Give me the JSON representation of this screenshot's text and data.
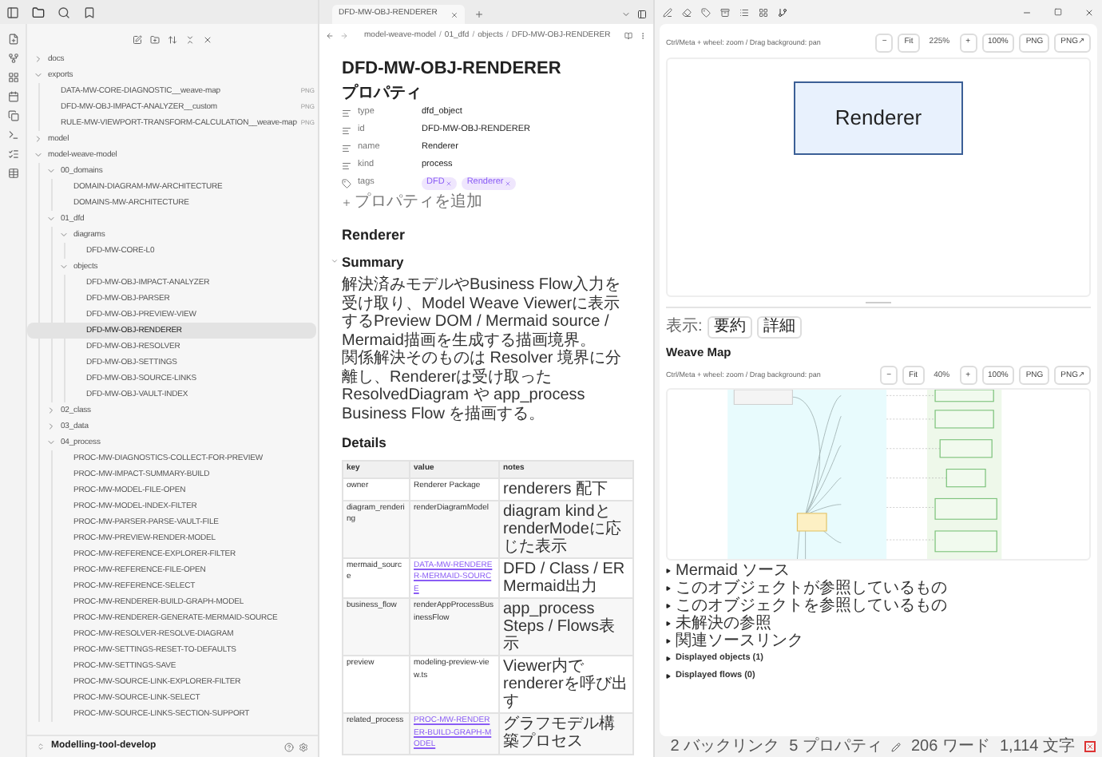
{
  "sidebar": {
    "tree": [
      {
        "label": "docs",
        "kind": "folder",
        "expanded": false,
        "selected": false
      },
      {
        "label": "exports",
        "kind": "folder",
        "expanded": true,
        "selected": false,
        "children": [
          {
            "label": "DATA-MW-CORE-DIAGNOSTIC__weave-map",
            "kind": "file",
            "badge": "PNG",
            "selected": false
          },
          {
            "label": "DFD-MW-OBJ-IMPACT-ANALYZER__custom",
            "kind": "file",
            "badge": "PNG",
            "selected": false
          },
          {
            "label": "RULE-MW-VIEWPORT-TRANSFORM-CALCULATION__weave-map",
            "kind": "file",
            "badge": "PNG",
            "selected": false
          }
        ]
      },
      {
        "label": "model",
        "kind": "folder",
        "expanded": false,
        "selected": false
      },
      {
        "label": "model-weave-model",
        "kind": "folder",
        "expanded": true,
        "selected": false,
        "children": [
          {
            "label": "00_domains",
            "kind": "folder",
            "expanded": true,
            "selected": false,
            "children": [
              {
                "label": "DOMAIN-DIAGRAM-MW-ARCHITECTURE",
                "kind": "file",
                "selected": false
              },
              {
                "label": "DOMAINS-MW-ARCHITECTURE",
                "kind": "file",
                "selected": false
              }
            ]
          },
          {
            "label": "01_dfd",
            "kind": "folder",
            "expanded": true,
            "selected": false,
            "children": [
              {
                "label": "diagrams",
                "kind": "folder",
                "expanded": true,
                "selected": false,
                "children": [
                  {
                    "label": "DFD-MW-CORE-L0",
                    "kind": "file",
                    "selected": false
                  }
                ]
              },
              {
                "label": "objects",
                "kind": "folder",
                "expanded": true,
                "selected": false,
                "children": [
                  {
                    "label": "DFD-MW-OBJ-IMPACT-ANALYZER",
                    "kind": "file",
                    "selected": false
                  },
                  {
                    "label": "DFD-MW-OBJ-PARSER",
                    "kind": "file",
                    "selected": false
                  },
                  {
                    "label": "DFD-MW-OBJ-PREVIEW-VIEW",
                    "kind": "file",
                    "selected": false
                  },
                  {
                    "label": "DFD-MW-OBJ-RENDERER",
                    "kind": "file",
                    "selected": true
                  },
                  {
                    "label": "DFD-MW-OBJ-RESOLVER",
                    "kind": "file",
                    "selected": false
                  },
                  {
                    "label": "DFD-MW-OBJ-SETTINGS",
                    "kind": "file",
                    "selected": false
                  },
                  {
                    "label": "DFD-MW-OBJ-SOURCE-LINKS",
                    "kind": "file",
                    "selected": false
                  },
                  {
                    "label": "DFD-MW-OBJ-VAULT-INDEX",
                    "kind": "file",
                    "selected": false
                  }
                ]
              }
            ]
          },
          {
            "label": "02_class",
            "kind": "folder",
            "expanded": false,
            "selected": false
          },
          {
            "label": "03_data",
            "kind": "folder",
            "expanded": false,
            "selected": false
          },
          {
            "label": "04_process",
            "kind": "folder",
            "expanded": true,
            "selected": false,
            "children": [
              {
                "label": "PROC-MW-DIAGNOSTICS-COLLECT-FOR-PREVIEW",
                "kind": "file",
                "selected": false
              },
              {
                "label": "PROC-MW-IMPACT-SUMMARY-BUILD",
                "kind": "file",
                "selected": false
              },
              {
                "label": "PROC-MW-MODEL-FILE-OPEN",
                "kind": "file",
                "selected": false
              },
              {
                "label": "PROC-MW-MODEL-INDEX-FILTER",
                "kind": "file",
                "selected": false
              },
              {
                "label": "PROC-MW-PARSER-PARSE-VAULT-FILE",
                "kind": "file",
                "selected": false
              },
              {
                "label": "PROC-MW-PREVIEW-RENDER-MODEL",
                "kind": "file",
                "selected": false
              },
              {
                "label": "PROC-MW-REFERENCE-EXPLORER-FILTER",
                "kind": "file",
                "selected": false
              },
              {
                "label": "PROC-MW-REFERENCE-FILE-OPEN",
                "kind": "file",
                "selected": false
              },
              {
                "label": "PROC-MW-REFERENCE-SELECT",
                "kind": "file",
                "selected": false
              },
              {
                "label": "PROC-MW-RENDERER-BUILD-GRAPH-MODEL",
                "kind": "file",
                "selected": false
              },
              {
                "label": "PROC-MW-RENDERER-GENERATE-MERMAID-SOURCE",
                "kind": "file",
                "selected": false
              },
              {
                "label": "PROC-MW-RESOLVER-RESOLVE-DIAGRAM",
                "kind": "file",
                "selected": false
              },
              {
                "label": "PROC-MW-SETTINGS-RESET-TO-DEFAULTS",
                "kind": "file",
                "selected": false
              },
              {
                "label": "PROC-MW-SETTINGS-SAVE",
                "kind": "file",
                "selected": false
              },
              {
                "label": "PROC-MW-SOURCE-LINK-EXPLORER-FILTER",
                "kind": "file",
                "selected": false
              },
              {
                "label": "PROC-MW-SOURCE-LINK-SELECT",
                "kind": "file",
                "selected": false
              },
              {
                "label": "PROC-MW-SOURCE-LINKS-SECTION-SUPPORT",
                "kind": "file",
                "selected": false
              }
            ]
          }
        ]
      }
    ],
    "vault": "Modelling-tool-develop"
  },
  "editor": {
    "tab": {
      "label": "DFD-MW-OBJ-RENDERER"
    },
    "breadcrumb": [
      "model-weave-model",
      "01_dfd",
      "objects",
      "DFD-MW-OBJ-RENDERER"
    ],
    "breadcrumb_separator": "/",
    "title": "DFD-MW-OBJ-RENDERER",
    "properties": {
      "heading": "プロパティ",
      "items": [
        {
          "key": "type",
          "kind": "text",
          "value": "dfd_object"
        },
        {
          "key": "id",
          "kind": "text",
          "value": "DFD-MW-OBJ-RENDERER"
        },
        {
          "key": "name",
          "kind": "text",
          "value": "Renderer"
        },
        {
          "key": "kind",
          "kind": "text",
          "value": "process"
        },
        {
          "key": "tags",
          "kind": "tags",
          "tags": [
            "DFD",
            "Renderer"
          ]
        }
      ],
      "add": "プロパティを追加"
    },
    "h1": "Renderer",
    "summary": {
      "heading": "Summary",
      "expanded": true,
      "paragraphs": [
        "解決済みモデルやBusiness Flow入力を受け取り、Model Weave Viewerに表示するPreview DOM / Mermaid source / Mermaid描画を生成する描画境界。",
        "関係解決そのものは Resolver 境界に分離し、Rendererは受け取ったResolvedDiagram や app_process Business Flow を描画する。"
      ]
    },
    "details": {
      "heading": "Details",
      "columns": [
        "key",
        "value",
        "notes"
      ],
      "rows": [
        {
          "key": "owner",
          "value": "Renderer Package",
          "kind": "text",
          "notes": "renderers 配下"
        },
        {
          "key": "diagram_rendering",
          "value": "renderDiagramModel",
          "kind": "text",
          "notes": "diagram kindと renderModeに応じた表示"
        },
        {
          "key": "mermaid_source",
          "value": "DATA-MW-RENDERER-MERMAID-SOURCE",
          "kind": "link",
          "notes": "DFD / Class / ER Mermaid出力"
        },
        {
          "key": "business_flow",
          "value": "renderAppProcessBusinessFlow",
          "kind": "text",
          "notes": "app_process Steps / Flows表示"
        },
        {
          "key": "preview",
          "value": "modeling-preview-view.ts",
          "kind": "text",
          "notes": "Viewer内でrendererを呼び出す"
        },
        {
          "key": "related_process",
          "value": "PROC-MW-RENDERER-BUILD-GRAPH-MODEL",
          "kind": "link",
          "notes": "グラフモデル構築プロセス"
        }
      ]
    }
  },
  "viewer": {
    "hint": "Ctrl/Meta + wheel: zoom / Drag background: pan",
    "controls": [
      {
        "label": "−",
        "kind": "button"
      },
      {
        "label": "Fit",
        "kind": "button"
      },
      {
        "label": "225%",
        "kind": "label"
      },
      {
        "label": "+",
        "kind": "button"
      },
      {
        "label": "100%",
        "kind": "button"
      },
      {
        "label": "PNG",
        "kind": "button"
      },
      {
        "label": "PNG↗",
        "kind": "button"
      }
    ],
    "node": "Renderer",
    "view_label": "表示:",
    "view_buttons": [
      "要約",
      "詳細"
    ],
    "map_heading": "Weave Map",
    "map_hint": "Ctrl/Meta + wheel: zoom / Drag background: pan",
    "map_controls": [
      {
        "label": "−",
        "kind": "button"
      },
      {
        "label": "Fit",
        "kind": "button"
      },
      {
        "label": "40%",
        "kind": "label"
      },
      {
        "label": "+",
        "kind": "button"
      },
      {
        "label": "100%",
        "kind": "button"
      },
      {
        "label": "PNG",
        "kind": "button"
      },
      {
        "label": "PNG↗",
        "kind": "button"
      }
    ],
    "sections": [
      {
        "label": "Mermaid ソース",
        "kind": "item"
      },
      {
        "label": "このオブジェクトが参照しているもの",
        "kind": "item"
      },
      {
        "label": "このオブジェクトを参照しているもの",
        "kind": "item"
      },
      {
        "label": "未解決の参照",
        "kind": "item"
      },
      {
        "label": "関連ソースリンク",
        "kind": "item"
      },
      {
        "label": "Displayed objects (1)",
        "kind": "section"
      },
      {
        "label": "Displayed flows (0)",
        "kind": "section"
      }
    ]
  },
  "status_bar": [
    "2 バックリンク",
    "5 プロパティ",
    "206 ワード",
    "1,114 文字"
  ]
}
